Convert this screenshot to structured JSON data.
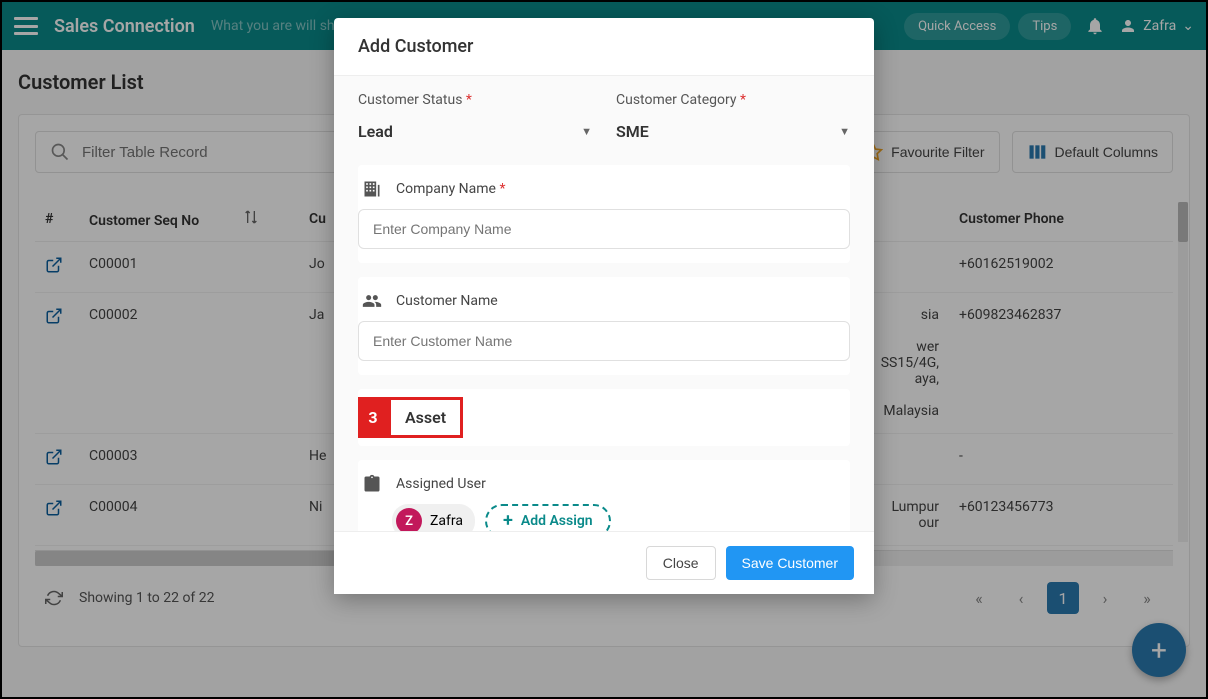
{
  "header": {
    "brand": "Sales Connection",
    "tagline": "What you are will sho",
    "quick_access": "Quick Access",
    "tips": "Tips",
    "user_name": "Zafra"
  },
  "page": {
    "title": "Customer List",
    "search_placeholder": "Filter Table Record",
    "favourite_filter": "Favourite Filter",
    "default_columns": "Default Columns",
    "showing": "Showing 1 to 22 of 22",
    "current_page": "1"
  },
  "columns": {
    "num": "#",
    "seq": "Customer Seq No",
    "name": "Cu",
    "phone": "Customer Phone"
  },
  "rows": [
    {
      "seq": "C00001",
      "name": "Jo",
      "addr": "",
      "phone": "+60162519002"
    },
    {
      "seq": "C00002",
      "name": "Ja",
      "addr": "sia\n\nwer\nSS15/4G,\naya,\n\nMalaysia",
      "phone": "+609823462837"
    },
    {
      "seq": "C00003",
      "name": "He",
      "addr": "",
      "phone": "-"
    },
    {
      "seq": "C00004",
      "name": "Ni",
      "addr": "Lumpur\nour",
      "phone": "+60123456773"
    }
  ],
  "modal": {
    "title": "Add Customer",
    "status_label": "Customer Status",
    "status_value": "Lead",
    "category_label": "Customer Category",
    "category_value": "SME",
    "company_label": "Company Name",
    "company_placeholder": "Enter Company Name",
    "customer_label": "Customer Name",
    "customer_placeholder": "Enter Customer Name",
    "asset_label": "Asset",
    "asset_badge": "3",
    "assigned_label": "Assigned User",
    "assigned_user": "Zafra",
    "assigned_initial": "Z",
    "add_assign": "Add Assign",
    "close": "Close",
    "save": "Save Customer"
  }
}
